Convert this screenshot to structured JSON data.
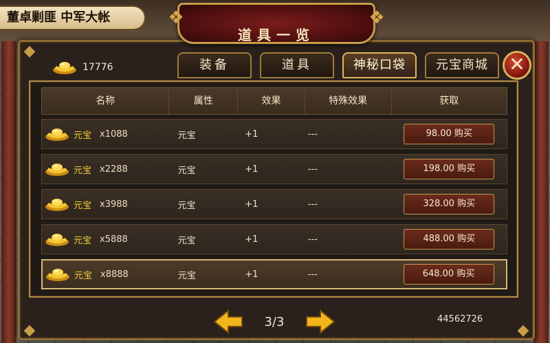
{
  "location": "董卓剿匪 中军大帐",
  "panel": {
    "title": "道具一览",
    "close_icon": "✕"
  },
  "currency": {
    "icon": "gold-ingot-icon",
    "amount": "17776"
  },
  "tabs": [
    {
      "label": "装备",
      "active": false
    },
    {
      "label": "道具",
      "active": false
    },
    {
      "label": "神秘口袋",
      "active": true
    },
    {
      "label": "元宝商城",
      "active": false
    }
  ],
  "table": {
    "headers": [
      "名称",
      "属性",
      "效果",
      "特殊效果",
      "获取"
    ],
    "rows": [
      {
        "name": "元宝",
        "qty": "x1088",
        "attr": "元宝",
        "effect": "+1",
        "special": "---",
        "buy": "98.00 购买"
      },
      {
        "name": "元宝",
        "qty": "x2288",
        "attr": "元宝",
        "effect": "+1",
        "special": "---",
        "buy": "198.00 购买"
      },
      {
        "name": "元宝",
        "qty": "x3988",
        "attr": "元宝",
        "effect": "+1",
        "special": "---",
        "buy": "328.00 购买"
      },
      {
        "name": "元宝",
        "qty": "x5888",
        "attr": "元宝",
        "effect": "+1",
        "special": "---",
        "buy": "488.00 购买"
      },
      {
        "name": "元宝",
        "qty": "x8888",
        "attr": "元宝",
        "effect": "+1",
        "special": "---",
        "buy": "648.00 购买"
      }
    ]
  },
  "pager": {
    "label": "3/3",
    "prev_icon": "arrow-left-icon",
    "next_icon": "arrow-right-icon"
  },
  "balance": "44562726",
  "colors": {
    "gold_text": "#f1d234",
    "accent_border": "#c79d48",
    "close_red": "#b5281a"
  }
}
